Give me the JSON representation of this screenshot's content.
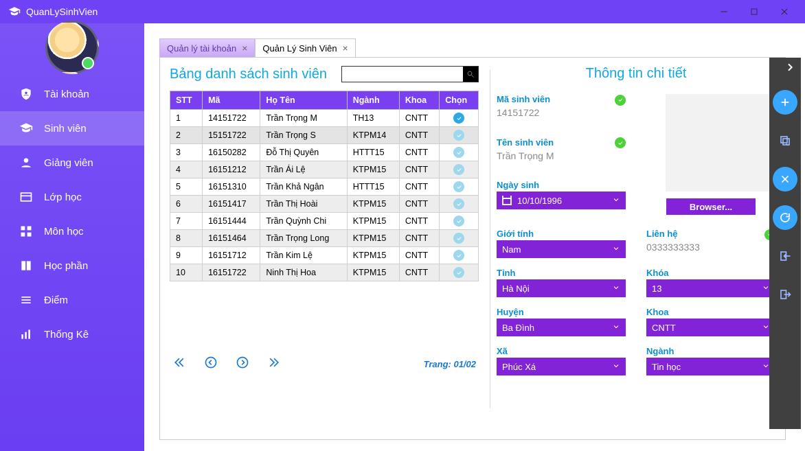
{
  "app": {
    "title": "QuanLySinhVien"
  },
  "window_controls": {
    "minimize": "minimize",
    "maximize": "maximize",
    "close": "close"
  },
  "sidebar": {
    "items": [
      {
        "label": "Tài khoản",
        "icon": "shield-user"
      },
      {
        "label": "Sinh viên",
        "icon": "graduation-cap"
      },
      {
        "label": "Giảng viên",
        "icon": "person"
      },
      {
        "label": "Lớp học",
        "icon": "class"
      },
      {
        "label": "Môn học",
        "icon": "grid"
      },
      {
        "label": "Học phần",
        "icon": "book"
      },
      {
        "label": "Điểm",
        "icon": "list"
      },
      {
        "label": "Thống Kê",
        "icon": "chart"
      }
    ],
    "active_index": 1
  },
  "tabs": [
    {
      "label": "Quản lý tài khoản",
      "active": false
    },
    {
      "label": "Quản Lý Sinh Viên",
      "active": true
    }
  ],
  "list": {
    "title": "Bảng danh sách sinh viên",
    "search_placeholder": "",
    "columns": [
      "STT",
      "Mã",
      "Họ Tên",
      "Ngành",
      "Khoa",
      "Chọn"
    ],
    "rows": [
      {
        "stt": "1",
        "ma": "14151722",
        "hoten": "Trần Trọng M",
        "nganh": "TH13",
        "khoa": "CNTT",
        "chon": true
      },
      {
        "stt": "2",
        "ma": "15151722",
        "hoten": "Trần Trọng S",
        "nganh": "KTPM14",
        "khoa": "CNTT",
        "chon": false
      },
      {
        "stt": "3",
        "ma": "16150282",
        "hoten": "Đỗ Thị Quyên",
        "nganh": "HTTT15",
        "khoa": "CNTT",
        "chon": false
      },
      {
        "stt": "4",
        "ma": "16151212",
        "hoten": "Trần Ái Lệ",
        "nganh": "KTPM15",
        "khoa": "CNTT",
        "chon": false
      },
      {
        "stt": "5",
        "ma": "16151310",
        "hoten": "Trần Khả Ngân",
        "nganh": "HTTT15",
        "khoa": "CNTT",
        "chon": false
      },
      {
        "stt": "6",
        "ma": "16151417",
        "hoten": "Trần Thị Hoài",
        "nganh": "KTPM15",
        "khoa": "CNTT",
        "chon": false
      },
      {
        "stt": "7",
        "ma": "16151444",
        "hoten": "Trần Quỳnh Chi",
        "nganh": "KTPM15",
        "khoa": "CNTT",
        "chon": false
      },
      {
        "stt": "8",
        "ma": "16151464",
        "hoten": "Trần Trọng Long",
        "nganh": "KTPM15",
        "khoa": "CNTT",
        "chon": false
      },
      {
        "stt": "9",
        "ma": "16151712",
        "hoten": "Trần Kim Lệ",
        "nganh": "KTPM15",
        "khoa": "CNTT",
        "chon": false
      },
      {
        "stt": "10",
        "ma": "16151722",
        "hoten": "Ninh Thị Hoa",
        "nganh": "KTPM15",
        "khoa": "CNTT",
        "chon": false
      }
    ],
    "selected_index": 1,
    "pager": {
      "label": "Trang: 01/02"
    }
  },
  "detail": {
    "title": "Thông tin chi tiết",
    "labels": {
      "ma": "Mã sinh viên",
      "ten": "Tên sinh viên",
      "ngaysinh": "Ngày sinh",
      "gioitinh": "Giới tính",
      "tinh": "Tỉnh",
      "huyen": "Huyện",
      "xa": "Xã",
      "lienhe": "Liên hệ",
      "khoa2": "Khóa",
      "khoa": "Khoa",
      "nganh": "Ngành",
      "browser": "Browser..."
    },
    "values": {
      "ma": "14151722",
      "ten": "Trần Trọng M",
      "ngaysinh": "10/10/1996",
      "gioitinh": "Nam",
      "tinh": "Hà Nội",
      "huyen": "Ba Đình",
      "xa": "Phúc Xá",
      "lienhe": "0333333333",
      "khoa2": "13",
      "khoa": "CNTT",
      "nganh": "Tin học"
    }
  },
  "actions": [
    "expand",
    "add",
    "copy",
    "delete",
    "refresh",
    "import",
    "export"
  ]
}
